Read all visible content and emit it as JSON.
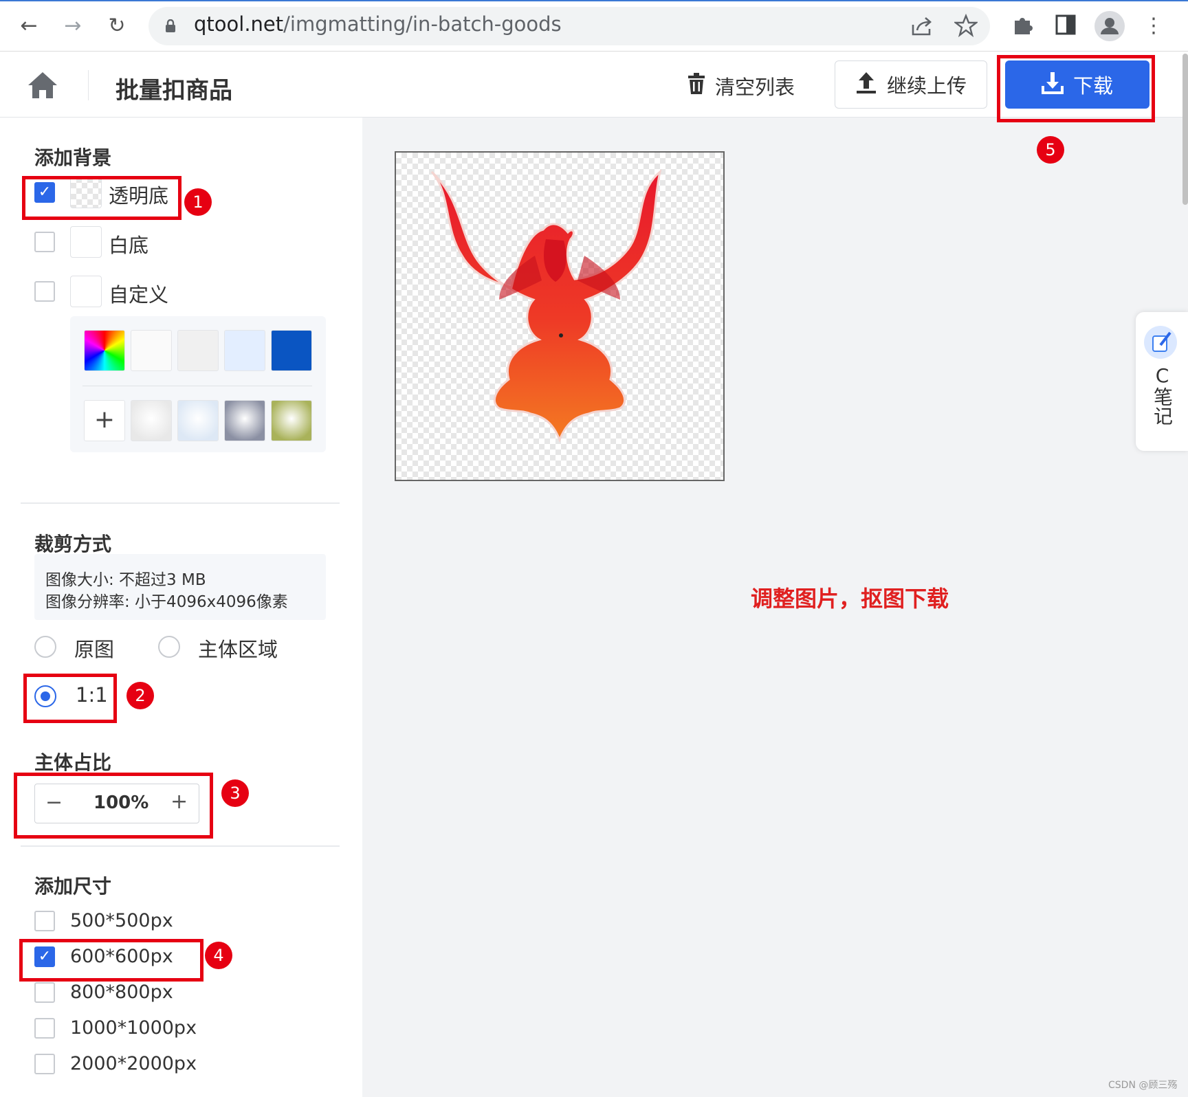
{
  "browser": {
    "url_host": "qtool.net",
    "url_path": "/imgmatting/in-batch-goods"
  },
  "header": {
    "title": "批量扣商品",
    "clear_label": "清空列表",
    "upload_label": "继续上传",
    "download_label": "下载"
  },
  "background": {
    "title": "添加背景",
    "options": [
      {
        "label": "透明底",
        "checked": true
      },
      {
        "label": "白底",
        "checked": false
      },
      {
        "label": "自定义",
        "checked": false
      }
    ],
    "palette_colors": [
      "#fafafa",
      "#f0f0f0",
      "#e3eeff",
      "#0a55c2"
    ],
    "palette_textures": [
      "#e8e8e8",
      "#dde8f5",
      "#8b90a3",
      "#a9b25a"
    ]
  },
  "crop": {
    "title": "裁剪方式",
    "info_size": "图像大小: 不超过3 MB",
    "info_resolution": "图像分辨率: 小于4096x4096像素",
    "options": [
      {
        "label": "原图",
        "selected": false
      },
      {
        "label": "主体区域",
        "selected": false
      },
      {
        "label": "1:1",
        "selected": true
      }
    ]
  },
  "ratio": {
    "title": "主体占比",
    "value": "100%",
    "minus": "−",
    "plus": "+"
  },
  "sizes": {
    "title": "添加尺寸",
    "items": [
      {
        "label": "500*500px",
        "checked": false
      },
      {
        "label": "600*600px",
        "checked": true
      },
      {
        "label": "800*800px",
        "checked": false
      },
      {
        "label": "1000*1000px",
        "checked": false
      },
      {
        "label": "2000*2000px",
        "checked": false
      }
    ]
  },
  "workspace": {
    "note": "调整图片，抠图下载"
  },
  "side_tab": {
    "text": "C笔记"
  },
  "annotations": [
    "1",
    "2",
    "3",
    "4",
    "5"
  ],
  "watermark": "CSDN @顾三殇",
  "colors": {
    "accent": "#2b67e8",
    "annotation_red": "#e60012",
    "note_red": "#e02020"
  }
}
